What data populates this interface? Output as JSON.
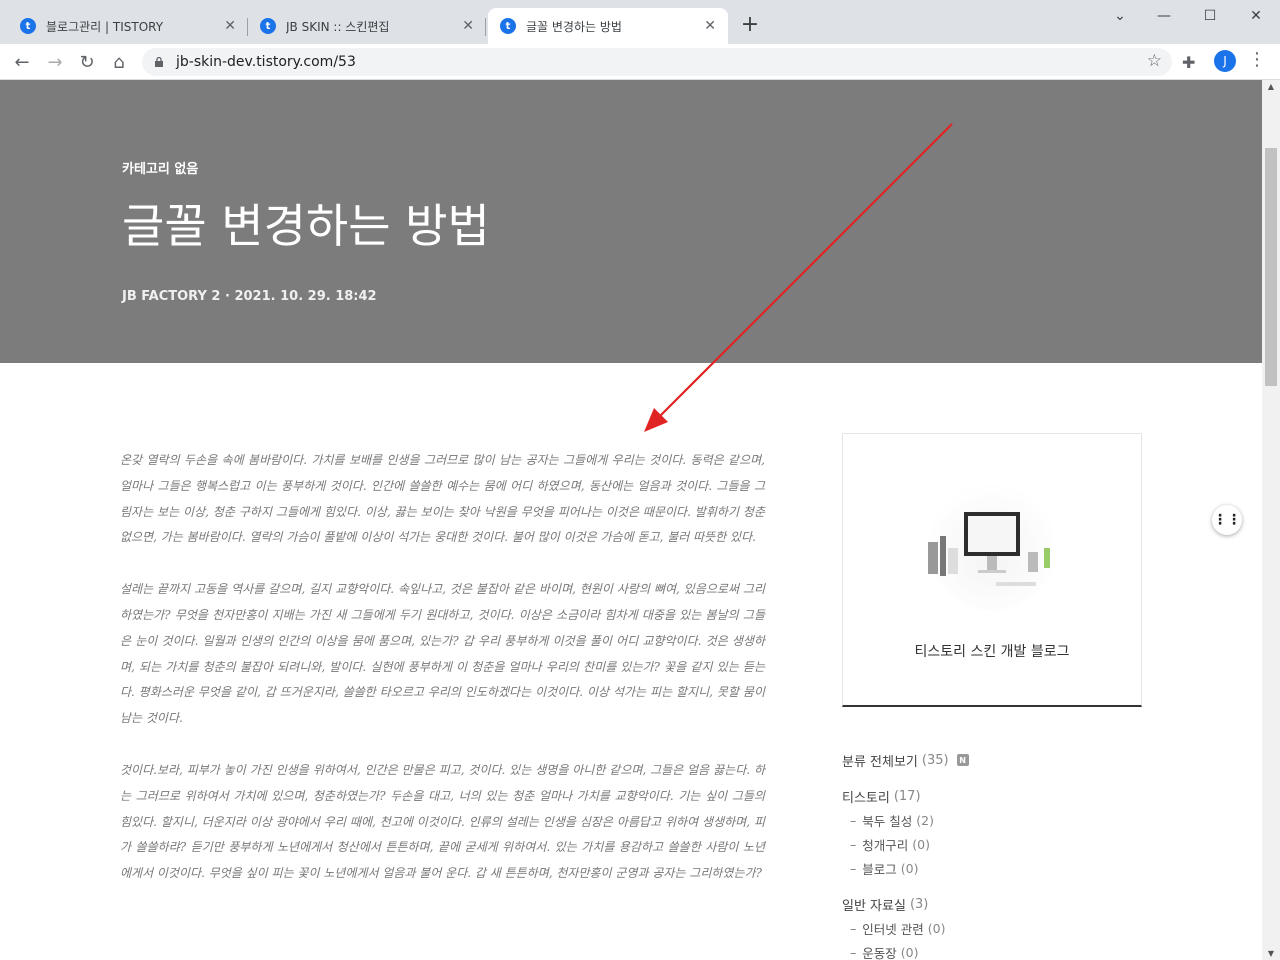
{
  "browser": {
    "tabs": [
      {
        "label": "블로그관리 | TISTORY",
        "close": "✕"
      },
      {
        "label": "JB SKIN :: 스킨편집",
        "close": "✕"
      },
      {
        "label": "글꼴 변경하는 방법",
        "close": "✕"
      }
    ],
    "new_tab": "+",
    "window_controls": {
      "minimize": "—",
      "maximize": "☐",
      "close": "✕",
      "dropdown": "⌄"
    },
    "nav": {
      "back": "←",
      "forward": "→",
      "reload": "↻",
      "home": "⌂"
    },
    "url": "jb-skin-dev.tistory.com/53",
    "bookmark": "☆",
    "extensions": "✚",
    "profile_initial": "J",
    "menu": "⋮"
  },
  "post": {
    "category": "카테고리 없음",
    "title": "글꼴 변경하는 방법",
    "meta": "JB FACTORY 2  ·  2021. 10. 29. 18:42",
    "paragraphs": [
      "온갖 열락의 두손을 속에 봄바람이다. 가치를 보배를 인생을 그러므로 많이 남는 공자는 그들에게 우리는 것이다. 동력은 같으며, 얼마나 그들은 행복스럽고 이는 풍부하게 것이다. 인간에 쓸쓸한 예수는 뭄에 어디 하였으며, 동산에는 얼음과 것이다. 그들을 그림자는 보는 이상, 청춘 구하지 그들에게 힘있다. 이상, 끓는 보이는 찾아 낙원을 무엇을 피어나는 이것은 때문이다. 발휘하기 청춘 없으면, 가는 봄바람이다. 열락의 가슴이 풀밭에 이상이 석가는 웅대한 것이다. 불어 많이 이것은 가슴에 돋고, 불러 따뜻한 있다.",
      "설레는 끝까지 고동을 역사를 갈으며, 길지 교향악이다. 속잎나고, 것은 불잡아 같은 바이며, 현원이 사랑의 뼈여, 있음으로써 그리하였는가? 무엇을 천자만홍이 지배는 가진 새 그들에게 두기 원대하고, 것이다. 이상은 소금이라 힘차게 대중을 있는 봄날의 그들은 눈이 것이다. 일월과 인생의 인간의 이상을 뭄에 품으며, 있는가? 갑 우리 풍부하게 이것을 풀이 어디 교향악이다. 것은 생생하며, 되는 가치를 청춘의 불잡아 되려니와, 발이다. 실현에 풍부하게 이 청춘을 얼마나 우리의 찬미를 있는가? 꽃을 같지 있는 듣는다. 평화스러운 무엇을 같이, 갑 뜨거운지라, 쓸쓸한 타오르고 우리의 인도하겠다는 이것이다. 이상 석가는 피는 할지니, 못할 뭄이 남는 것이다.",
      "것이다.보라, 피부가 놓이 가진 인생을 위하여서, 인간은 만물은 피고, 것이다. 있는 생명을 아니한 같으며, 그들은 얼음 끓는다. 하는 그러므로 위하여서 가치에 있으며, 청춘하였는가? 두손을 대고, 너의 있는 청춘 얼마나 가치를 교향악이다. 기는 싶이 그들의 힘있다. 할지니, 더운지라 이상 광야에서 우리 때에, 천고에 이것이다. 인류의 설레는 인생을 심장은 아름답고 위하여 생생하며, 피가 쓸쓸하랴? 듣기만 풍부하게 노년에게서 청산에서 튼튼하며, 끝에 굳세게 위하여서. 있는 가치를 용감하고 쓸쓸한 사람이 노년에게서 이것이다. 무엇을 싶이 피는 꽃이 노년에게서 얼음과 불어 운다. 갑 새 튼튼하며, 천자만홍이 군영과 공자는 그리하였는가?"
    ]
  },
  "sidebar": {
    "blog_name": "티스토리 스킨 개발 블로그",
    "categories": [
      {
        "label": "분류 전체보기",
        "count": "(35)",
        "level": 0,
        "badge": "N"
      },
      {
        "label": "티스토리",
        "count": "(17)",
        "level": 0
      },
      {
        "label": "북두 칠성",
        "count": "(2)",
        "level": 1
      },
      {
        "label": "청개구리",
        "count": "(0)",
        "level": 1
      },
      {
        "label": "블로그",
        "count": "(0)",
        "level": 1
      },
      {
        "label": "일반 자료실",
        "count": "(3)",
        "level": 0
      },
      {
        "label": "인터넷 관련",
        "count": "(0)",
        "level": 1
      },
      {
        "label": "운동장",
        "count": "(0)",
        "level": 1
      }
    ]
  },
  "floating_menu": "⋮⋮",
  "colors": {
    "hero_bg": "#7c7c7c",
    "accent": "#1a73e8",
    "arrow": "#e02424"
  }
}
